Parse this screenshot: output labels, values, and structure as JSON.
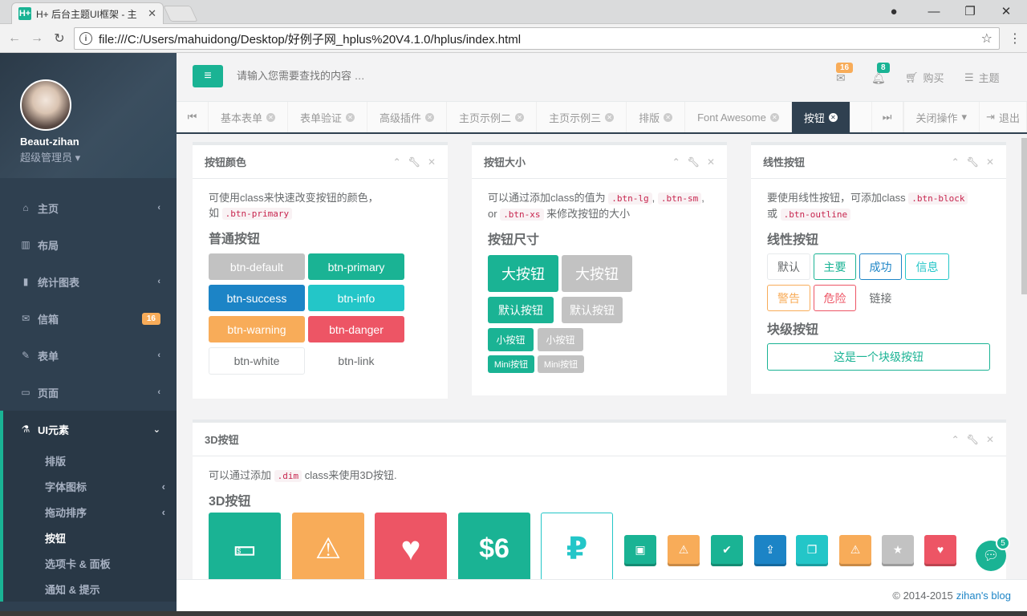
{
  "browser": {
    "tab_title": "H+ 后台主题UI框架 - 主",
    "favicon": "H+",
    "url": "file:///C:/Users/mahuidong/Desktop/好例子网_hplus%20V4.1.0/hplus/index.html"
  },
  "profile": {
    "name": "Beaut-zihan",
    "role": "超级管理员"
  },
  "sidebar": {
    "items": [
      {
        "icon": "home-icon",
        "label": "主页"
      },
      {
        "icon": "columns-icon",
        "label": "布局"
      },
      {
        "icon": "bar-chart-icon",
        "label": "统计图表"
      },
      {
        "icon": "envelope-icon",
        "label": "信箱",
        "badge": "16"
      },
      {
        "icon": "edit-icon",
        "label": "表单"
      },
      {
        "icon": "desktop-icon",
        "label": "页面"
      },
      {
        "icon": "flask-icon",
        "label": "UI元素"
      }
    ],
    "sub": [
      "排版",
      "字体图标",
      "拖动排序",
      "按钮",
      "选项卡 & 面板",
      "通知 & 提示"
    ]
  },
  "topbar": {
    "search_placeholder": "请输入您需要查找的内容 …",
    "mail_badge": "16",
    "bell_badge": "8",
    "buy": "购买",
    "theme": "主题"
  },
  "content_tabs": [
    "基本表单",
    "表单验证",
    "高级插件",
    "主页示例二",
    "主页示例三",
    "排版",
    "Font Awesome",
    "按钮"
  ],
  "tab_actions": {
    "close_ops": "关闭操作",
    "logout": "退出"
  },
  "colors": {
    "primary": "#1ab394",
    "success": "#1c84c6",
    "info": "#23c6c8",
    "warning": "#f8ac59",
    "danger": "#ed5565",
    "sidebar": "#2f4050"
  },
  "panel_colors": {
    "title": "按钮颜色",
    "desc_1": "可使用class来快速改变按钮的颜色，",
    "desc_2": "如",
    "code": ".btn-primary",
    "heading": "普通按钮",
    "buttons": [
      "btn-default",
      "btn-primary",
      "btn-success",
      "btn-info",
      "btn-warning",
      "btn-danger",
      "btn-white",
      "btn-link"
    ]
  },
  "panel_sizes": {
    "title": "按钮大小",
    "desc_1": "可以通过添加class的值为",
    "code_lg": ".btn-lg",
    "code_sm": ".btn-sm",
    "desc_or": "or",
    "code_xs": ".btn-xs",
    "desc_2": "来修改按钮的大小",
    "heading": "按钮尺寸",
    "lg": "大按钮",
    "md": "默认按钮",
    "sm": "小按钮",
    "xs": "Mini按钮"
  },
  "panel_outline": {
    "title": "线性按钮",
    "desc_1": "要使用线性按钮，可添加class",
    "code_block": ".btn-block",
    "desc_or": "或",
    "code_outline": ".btn-outline",
    "heading": "线性按钮",
    "buttons": [
      "默认",
      "主要",
      "成功",
      "信息",
      "警告",
      "危险",
      "链接"
    ],
    "block_heading": "块级按钮",
    "block_button": "这是一个块级按钮"
  },
  "panel_3d": {
    "title": "3D按钮",
    "desc_1": "可以通过添加",
    "code": ".dim",
    "desc_2": "class来使用3D按钮.",
    "heading": "3D按钮",
    "big_6_label": "$6"
  },
  "footer": {
    "copyright": "© 2014-2015",
    "link": "zihan's blog"
  },
  "chat_badge": "5"
}
